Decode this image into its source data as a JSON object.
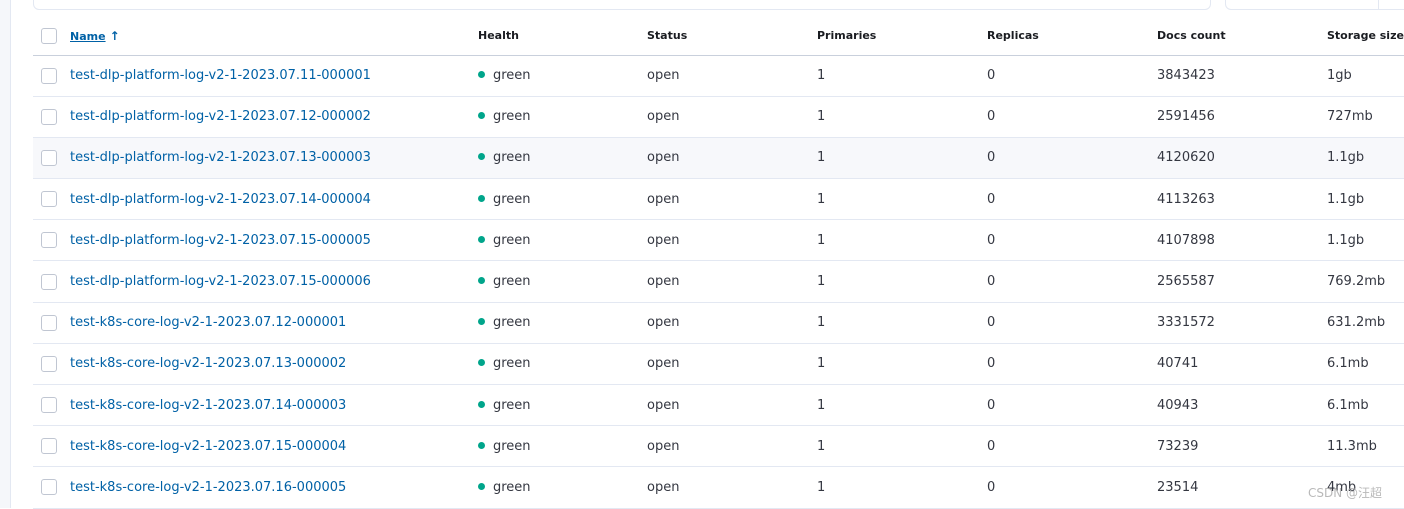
{
  "table": {
    "headers": {
      "name": "Name",
      "health": "Health",
      "status": "Status",
      "primaries": "Primaries",
      "replicas": "Replicas",
      "docs_count": "Docs count",
      "storage_size": "Storage size"
    },
    "sort_icon": "arrow-up-icon",
    "rows": [
      {
        "name": "test-dlp-platform-log-v2-1-2023.07.11-000001",
        "health": "green",
        "status": "open",
        "primaries": "1",
        "replicas": "0",
        "docs_count": "3843423",
        "storage_size": "1gb"
      },
      {
        "name": "test-dlp-platform-log-v2-1-2023.07.12-000002",
        "health": "green",
        "status": "open",
        "primaries": "1",
        "replicas": "0",
        "docs_count": "2591456",
        "storage_size": "727mb"
      },
      {
        "name": "test-dlp-platform-log-v2-1-2023.07.13-000003",
        "health": "green",
        "status": "open",
        "primaries": "1",
        "replicas": "0",
        "docs_count": "4120620",
        "storage_size": "1.1gb"
      },
      {
        "name": "test-dlp-platform-log-v2-1-2023.07.14-000004",
        "health": "green",
        "status": "open",
        "primaries": "1",
        "replicas": "0",
        "docs_count": "4113263",
        "storage_size": "1.1gb"
      },
      {
        "name": "test-dlp-platform-log-v2-1-2023.07.15-000005",
        "health": "green",
        "status": "open",
        "primaries": "1",
        "replicas": "0",
        "docs_count": "4107898",
        "storage_size": "1.1gb"
      },
      {
        "name": "test-dlp-platform-log-v2-1-2023.07.15-000006",
        "health": "green",
        "status": "open",
        "primaries": "1",
        "replicas": "0",
        "docs_count": "2565587",
        "storage_size": "769.2mb"
      },
      {
        "name": "test-k8s-core-log-v2-1-2023.07.12-000001",
        "health": "green",
        "status": "open",
        "primaries": "1",
        "replicas": "0",
        "docs_count": "3331572",
        "storage_size": "631.2mb"
      },
      {
        "name": "test-k8s-core-log-v2-1-2023.07.13-000002",
        "health": "green",
        "status": "open",
        "primaries": "1",
        "replicas": "0",
        "docs_count": "40741",
        "storage_size": "6.1mb"
      },
      {
        "name": "test-k8s-core-log-v2-1-2023.07.14-000003",
        "health": "green",
        "status": "open",
        "primaries": "1",
        "replicas": "0",
        "docs_count": "40943",
        "storage_size": "6.1mb"
      },
      {
        "name": "test-k8s-core-log-v2-1-2023.07.15-000004",
        "health": "green",
        "status": "open",
        "primaries": "1",
        "replicas": "0",
        "docs_count": "73239",
        "storage_size": "11.3mb"
      },
      {
        "name": "test-k8s-core-log-v2-1-2023.07.16-000005",
        "health": "green",
        "status": "open",
        "primaries": "1",
        "replicas": "0",
        "docs_count": "23514",
        "storage_size": "4mb"
      }
    ]
  },
  "colors": {
    "link": "#0061a6",
    "health_green": "#00a58b"
  },
  "watermark": "CSDN @汪超"
}
